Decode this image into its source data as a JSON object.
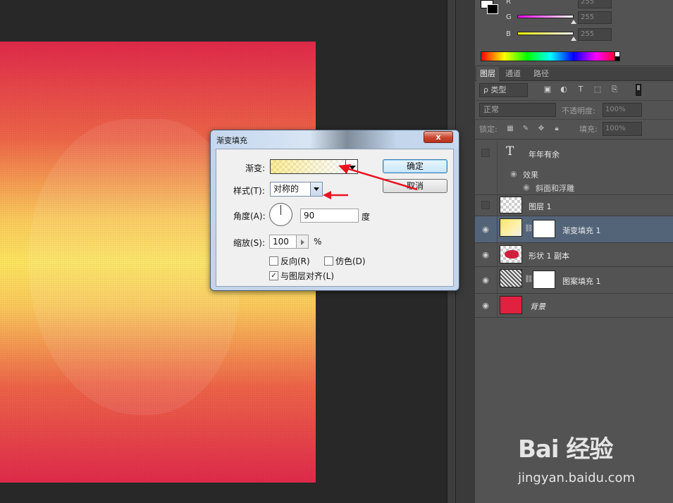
{
  "color_panel": {
    "channels": [
      {
        "label": "R",
        "value": "255",
        "gradient": "#ff00ff"
      },
      {
        "label": "G",
        "value": "255",
        "gradient": "#ff00ff"
      },
      {
        "label": "B",
        "value": "255",
        "gradient": "#ffff00"
      }
    ]
  },
  "layers_panel": {
    "tabs": [
      "图层",
      "通道",
      "路径"
    ],
    "filter_kind": "ρ 类型",
    "blend_mode": "正常",
    "opacity_label": "不透明度:",
    "opacity_value": "100%",
    "lock_label": "锁定:",
    "fill_label": "填充:",
    "fill_value": "100%",
    "layers": [
      {
        "name": "年年有余",
        "type": "text",
        "visible": false
      },
      {
        "name": "效果",
        "type": "effects-header"
      },
      {
        "name": "斜面和浮雕",
        "type": "effect"
      },
      {
        "name": "图层 1",
        "type": "pixel",
        "visible": false
      },
      {
        "name": "渐变填充 1",
        "type": "gradient-fill",
        "visible": true,
        "selected": true
      },
      {
        "name": "形状 1 副本",
        "type": "shape",
        "visible": true
      },
      {
        "name": "图案填充 1",
        "type": "pattern-fill",
        "visible": true
      },
      {
        "name": "背景",
        "type": "background",
        "visible": true,
        "color": "#e0213f"
      }
    ]
  },
  "dialog": {
    "title": "渐变填充",
    "close_symbol": "x",
    "gradient_label": "渐变:",
    "style_label": "样式(T):",
    "style_value": "对称的",
    "angle_label": "角度(A):",
    "angle_value": "90",
    "angle_unit": "度",
    "scale_label": "缩放(S):",
    "scale_value": "100",
    "scale_unit": "%",
    "reverse_label": "反向(R)",
    "reverse_checked": false,
    "dither_label": "仿色(D)",
    "dither_checked": false,
    "align_label": "与图层对齐(L)",
    "align_checked": true,
    "ok_label": "确定",
    "cancel_label": "取消"
  },
  "watermark": {
    "logo": "Bai 经验",
    "url": "jingyan.baidu.com"
  },
  "colors": {
    "annotation_arrow": "#e8141f",
    "panel_bg": "#535353",
    "selected_layer": "#536479"
  }
}
